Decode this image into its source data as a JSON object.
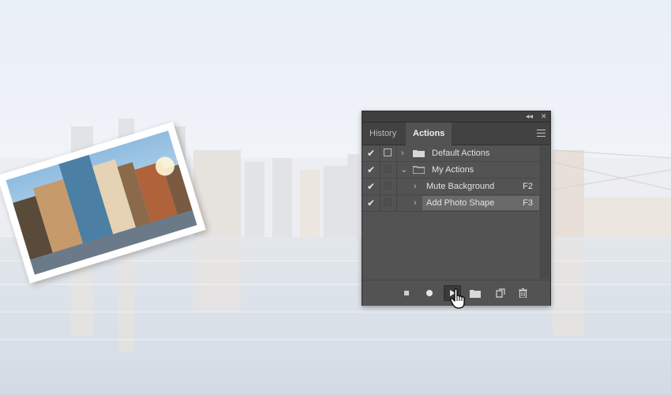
{
  "panel": {
    "tabs": [
      {
        "label": "History",
        "active": false
      },
      {
        "label": "Actions",
        "active": true
      }
    ],
    "titlebar_icons": [
      "collapse-icon",
      "close-icon"
    ],
    "menu_icon": "panel-menu-icon"
  },
  "actions": [
    {
      "label": "Default Actions",
      "type": "set",
      "checked": true,
      "dialog": true,
      "expanded": false,
      "shortcut": ""
    },
    {
      "label": "My Actions",
      "type": "set",
      "checked": true,
      "dialog": false,
      "expanded": true,
      "shortcut": ""
    },
    {
      "label": "Mute Background",
      "type": "action",
      "checked": true,
      "dialog": false,
      "expanded": false,
      "shortcut": "F2"
    },
    {
      "label": "Add Photo Shape",
      "type": "action",
      "checked": true,
      "dialog": false,
      "expanded": false,
      "shortcut": "F3",
      "selected": true
    }
  ],
  "toolbar": {
    "buttons": [
      "stop-icon",
      "record-icon",
      "play-icon",
      "new-set-icon",
      "new-action-icon",
      "delete-icon"
    ],
    "pressed": "play-icon"
  },
  "colors": {
    "panel_bg": "#535353",
    "tab_bar_bg": "#424242",
    "selected_row": "#6a6a6a",
    "sky": "#e8eef6",
    "water": "#d7dfe8"
  }
}
